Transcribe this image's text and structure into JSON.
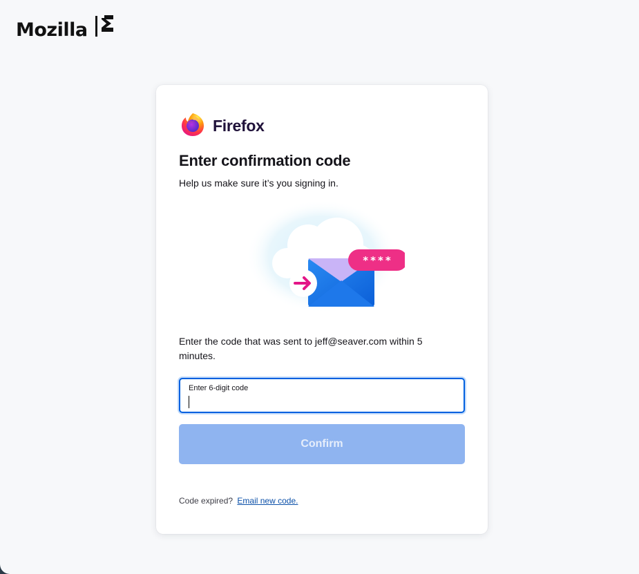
{
  "header": {
    "brand_word": "Mozilla",
    "brand_mark_icon": "mozilla-m-icon"
  },
  "card": {
    "product_name": "Firefox",
    "product_icon": "firefox-logo-icon",
    "title": "Enter confirmation code",
    "subtitle": "Help us make sure it’s you signing in.",
    "illustration": {
      "icon": "email-code-illustration",
      "badge_text": "****"
    },
    "instruction": "Enter the code that was sent to jeff@seaver.com within 5 minutes.",
    "code_field": {
      "label": "Enter 6-digit code",
      "value": ""
    },
    "confirm_label": "Confirm",
    "expired_text": "Code expired?",
    "resend_link": "Email new code."
  },
  "colors": {
    "primary_focus": "#0060df",
    "button_disabled": "#8fb4f0",
    "link": "#0a4fa8"
  }
}
